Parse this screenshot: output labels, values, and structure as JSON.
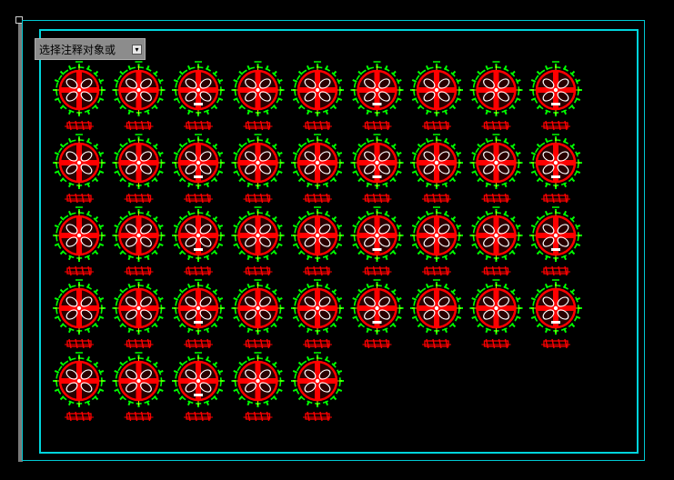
{
  "command_prompt": {
    "text": "选择注释对象或",
    "button_icon": "dropdown-arrow-icon"
  },
  "drawing": {
    "layout": {
      "rows": 5,
      "columns": 9,
      "last_row_count": 5
    },
    "symbol_count": 41,
    "colors": {
      "frame": "#00d4dc",
      "symbol_ring": "#00ff00",
      "symbol_core": "#ff0000",
      "symbol_inner": "#ffffff",
      "centerline": "#ffff00",
      "label": "#ff0000"
    }
  }
}
